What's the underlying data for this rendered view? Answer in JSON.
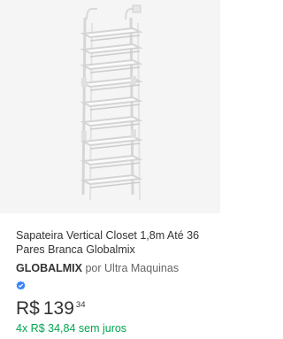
{
  "product": {
    "title": "Sapateira Vertical Closet 1,8m Até 36 Pares Branca Globalmix",
    "image_alt": "Sapateira vertical branca de porta",
    "seller": {
      "brand": "GLOBALMIX",
      "by_text": "por Ultra Maquinas",
      "verified_icon": "verified-badge-icon"
    },
    "price": {
      "currency": "R$",
      "integer": "139",
      "cents": "34"
    },
    "installments": "4x R$ 34,84 sem juros"
  },
  "colors": {
    "image_background": "#f5f5f5",
    "installments_green": "#00a650",
    "verified_blue": "#3483fa",
    "text": "#333333"
  }
}
